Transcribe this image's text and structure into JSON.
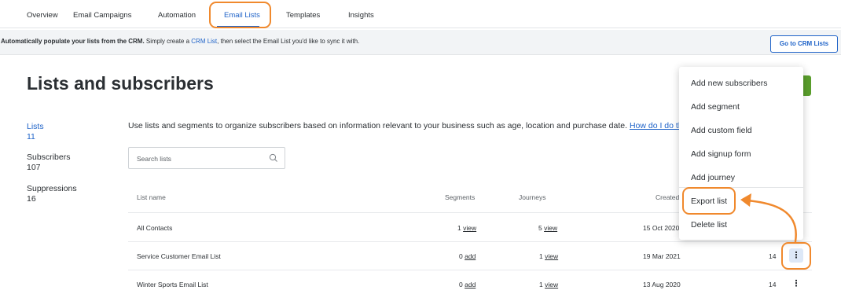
{
  "nav": {
    "tabs": [
      {
        "label": "Overview"
      },
      {
        "label": "Email Campaigns"
      },
      {
        "label": "Automation"
      },
      {
        "label": "Email Lists"
      },
      {
        "label": "Templates"
      },
      {
        "label": "Insights"
      }
    ],
    "active_tab": "Email Lists"
  },
  "crm_banner": {
    "bold_text": "Automatically populate your lists from the CRM.",
    "text_before_link": " Simply create a ",
    "link": "CRM List",
    "text_after_link": ", then select the Email List you'd like to sync it with.",
    "button": "Go to CRM Lists"
  },
  "page_title": "Lists and subscribers",
  "stats": [
    {
      "label": "Lists",
      "value": "11"
    },
    {
      "label": "Subscribers",
      "value": "107"
    },
    {
      "label": "Suppressions",
      "value": "16"
    }
  ],
  "intro": {
    "text": "Use lists and segments to organize subscribers based on information relevant to your business such as age, location and purchase date. ",
    "link": "How do I do this?"
  },
  "search": {
    "placeholder": "Search lists",
    "icon": "search-icon"
  },
  "table": {
    "headers": {
      "name": "List name",
      "segments": "Segments",
      "journeys": "Journeys",
      "created": "Created"
    },
    "rows": [
      {
        "name": "All Contacts",
        "segments_count": "1",
        "segments_action": "view",
        "journeys_count": "5",
        "journeys_action": "view",
        "created": "15 Oct 2020",
        "subscribers": "",
        "menu": "⋮"
      },
      {
        "name": "Service Customer Email List",
        "segments_count": "0",
        "segments_action": "add",
        "journeys_count": "1",
        "journeys_action": "view",
        "created": "19 Mar 2021",
        "subscribers": "14",
        "menu": "⋮"
      },
      {
        "name": "Winter Sports Email List",
        "segments_count": "0",
        "segments_action": "add",
        "journeys_count": "1",
        "journeys_action": "view",
        "created": "13 Aug 2020",
        "subscribers": "14",
        "menu": "⋮"
      }
    ]
  },
  "menu": {
    "items": [
      {
        "label": "Add new subscribers"
      },
      {
        "label": "Add segment"
      },
      {
        "label": "Add custom field"
      },
      {
        "label": "Add signup form"
      },
      {
        "label": "Add journey"
      },
      {
        "label": "Export list"
      },
      {
        "label": "Delete list"
      }
    ]
  },
  "colors": {
    "accent": "#1f63c8",
    "highlight": "#f0892d",
    "primary_button": "#5a9e2c"
  }
}
